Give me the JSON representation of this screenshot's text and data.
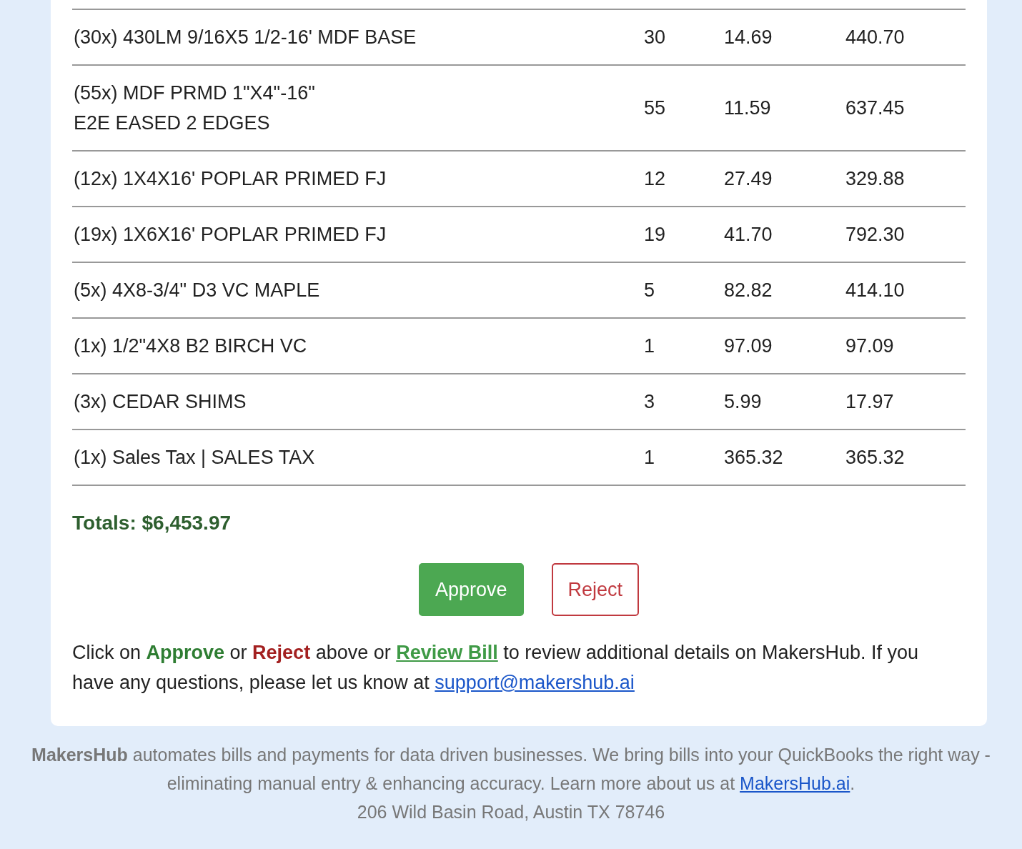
{
  "table": {
    "rows": [
      {
        "description": "(30x) 430LM 9/16X5 1/2-16' MDF BASE",
        "qty": "30",
        "price": "14.69",
        "total": "440.70"
      },
      {
        "description": "(55x) MDF PRMD 1\"X4\"-16\"\nE2E EASED 2 EDGES",
        "qty": "55",
        "price": "11.59",
        "total": "637.45"
      },
      {
        "description": "(12x) 1X4X16' POPLAR PRIMED FJ",
        "qty": "12",
        "price": "27.49",
        "total": "329.88"
      },
      {
        "description": "(19x) 1X6X16' POPLAR PRIMED FJ",
        "qty": "19",
        "price": "41.70",
        "total": "792.30"
      },
      {
        "description": "(5x) 4X8-3/4\" D3 VC MAPLE",
        "qty": "5",
        "price": "82.82",
        "total": "414.10"
      },
      {
        "description": "(1x) 1/2\"4X8 B2 BIRCH VC",
        "qty": "1",
        "price": "97.09",
        "total": "97.09"
      },
      {
        "description": "(3x) CEDAR SHIMS",
        "qty": "3",
        "price": "5.99",
        "total": "17.97"
      },
      {
        "description": "(1x) Sales Tax | SALES TAX",
        "qty": "1",
        "price": "365.32",
        "total": "365.32"
      }
    ]
  },
  "totals": "Totals: $6,453.97",
  "buttons": [
    {
      "kind": "approve",
      "label": "Approve"
    },
    {
      "kind": "reject",
      "label": "Reject"
    }
  ],
  "message": [
    {
      "kind": "text",
      "text": "Click on "
    },
    {
      "kind": "approve",
      "text": "Approve"
    },
    {
      "kind": "text",
      "text": " or "
    },
    {
      "kind": "reject",
      "text": "Reject"
    },
    {
      "kind": "text",
      "text": " above or "
    },
    {
      "kind": "review_link",
      "text": "Review Bill"
    },
    {
      "kind": "text",
      "text": " to review additional details on MakersHub. If you have any questions, please let us know at "
    },
    {
      "kind": "email_link",
      "text": "support@makershub.ai"
    }
  ],
  "footer": {
    "text": "**MakersHub** automates bills and payments for data driven businesses. We bring bills into your QuickBooks the right way - eliminating manual entry & enhancing accuracy. Learn more about us at ",
    "link": "MakersHub.ai",
    "after": ".",
    "address": "206 Wild Basin Road, Austin TX 78746"
  }
}
